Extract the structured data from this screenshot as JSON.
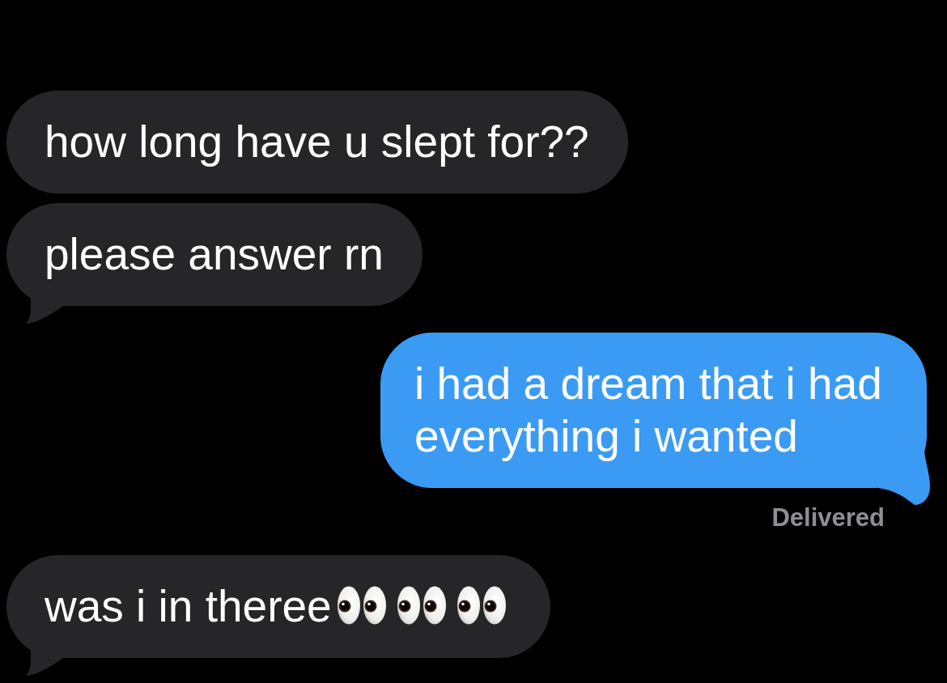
{
  "messages": [
    {
      "kind": "received",
      "text": "how long have u slept for??",
      "tail": false
    },
    {
      "kind": "received",
      "text": "please answer rn",
      "tail": true
    },
    {
      "kind": "sent",
      "text": "i had a dream that i had everything i wanted",
      "tail": true,
      "status": "Delivered"
    },
    {
      "kind": "received",
      "text": "was i in theree",
      "tail": true,
      "emoji": [
        {
          "kind": "eyes"
        },
        {
          "kind": "eyes"
        },
        {
          "kind": "eyes"
        }
      ]
    }
  ]
}
